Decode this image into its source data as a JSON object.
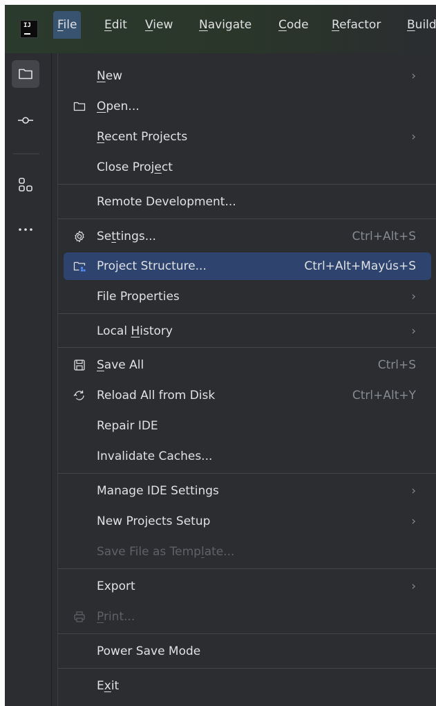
{
  "menubar": {
    "logo_text": "IJ",
    "items": [
      {
        "mnemonic": "F",
        "rest": "ile"
      },
      {
        "mnemonic": "E",
        "rest": "dit"
      },
      {
        "mnemonic": "V",
        "rest": "iew"
      },
      {
        "mnemonic": "N",
        "rest": "avigate"
      },
      {
        "mnemonic": "C",
        "rest": "ode"
      },
      {
        "mnemonic": "R",
        "rest": "efactor"
      },
      {
        "mnemonic": "B",
        "rest": "uild"
      }
    ]
  },
  "toolstripe": {
    "icons": [
      "folder-icon",
      "commit-icon",
      "structure-icon",
      "more-icon"
    ]
  },
  "file_menu": {
    "items": [
      {
        "pre": "",
        "mnemonic": "N",
        "post": "ew",
        "shortcut": "",
        "submenu": true,
        "icon": "",
        "disabled": false,
        "highlighted": false
      },
      {
        "pre": "",
        "mnemonic": "O",
        "post": "pen...",
        "shortcut": "",
        "submenu": false,
        "icon": "folder-icon",
        "disabled": false,
        "highlighted": false
      },
      {
        "pre": "",
        "mnemonic": "R",
        "post": "ecent Projects",
        "shortcut": "",
        "submenu": true,
        "icon": "",
        "disabled": false,
        "highlighted": false
      },
      {
        "pre": "Close Proj",
        "mnemonic": "e",
        "post": "ct",
        "shortcut": "",
        "submenu": false,
        "icon": "",
        "disabled": false,
        "highlighted": false
      },
      {
        "pre": "Remote Development...",
        "mnemonic": "",
        "post": "",
        "shortcut": "",
        "submenu": false,
        "icon": "",
        "disabled": false,
        "highlighted": false
      },
      {
        "pre": "Se",
        "mnemonic": "t",
        "post": "tings...",
        "shortcut": "Ctrl+Alt+S",
        "submenu": false,
        "icon": "gear-icon",
        "disabled": false,
        "highlighted": false
      },
      {
        "pre": "Project Structure...",
        "mnemonic": "",
        "post": "",
        "shortcut": "Ctrl+Alt+Mayús+S",
        "submenu": false,
        "icon": "project-structure-icon",
        "disabled": false,
        "highlighted": true
      },
      {
        "pre": "File Properties",
        "mnemonic": "",
        "post": "",
        "shortcut": "",
        "submenu": true,
        "icon": "",
        "disabled": false,
        "highlighted": false
      },
      {
        "pre": "Local ",
        "mnemonic": "H",
        "post": "istory",
        "shortcut": "",
        "submenu": true,
        "icon": "",
        "disabled": false,
        "highlighted": false
      },
      {
        "pre": "",
        "mnemonic": "S",
        "post": "ave All",
        "shortcut": "Ctrl+S",
        "submenu": false,
        "icon": "save-icon",
        "disabled": false,
        "highlighted": false
      },
      {
        "pre": "Reload All from Disk",
        "mnemonic": "",
        "post": "",
        "shortcut": "Ctrl+Alt+Y",
        "submenu": false,
        "icon": "reload-icon",
        "disabled": false,
        "highlighted": false
      },
      {
        "pre": "Repair IDE",
        "mnemonic": "",
        "post": "",
        "shortcut": "",
        "submenu": false,
        "icon": "",
        "disabled": false,
        "highlighted": false
      },
      {
        "pre": "Invalidate Caches...",
        "mnemonic": "",
        "post": "",
        "shortcut": "",
        "submenu": false,
        "icon": "",
        "disabled": false,
        "highlighted": false
      },
      {
        "pre": "Manage IDE Settings",
        "mnemonic": "",
        "post": "",
        "shortcut": "",
        "submenu": true,
        "icon": "",
        "disabled": false,
        "highlighted": false
      },
      {
        "pre": "New Projects Setup",
        "mnemonic": "",
        "post": "",
        "shortcut": "",
        "submenu": true,
        "icon": "",
        "disabled": false,
        "highlighted": false
      },
      {
        "pre": "Save File as Temp",
        "mnemonic": "l",
        "post": "ate...",
        "shortcut": "",
        "submenu": false,
        "icon": "",
        "disabled": true,
        "highlighted": false
      },
      {
        "pre": "Export",
        "mnemonic": "",
        "post": "",
        "shortcut": "",
        "submenu": true,
        "icon": "",
        "disabled": false,
        "highlighted": false
      },
      {
        "pre": "",
        "mnemonic": "P",
        "post": "rint...",
        "shortcut": "",
        "submenu": false,
        "icon": "print-icon",
        "disabled": true,
        "highlighted": false
      },
      {
        "pre": "Power Save Mode",
        "mnemonic": "",
        "post": "",
        "shortcut": "",
        "submenu": false,
        "icon": "",
        "disabled": false,
        "highlighted": false
      },
      {
        "pre": "E",
        "mnemonic": "x",
        "post": "it",
        "shortcut": "",
        "submenu": false,
        "icon": "",
        "disabled": false,
        "highlighted": false
      }
    ],
    "submenu_glyph": "›"
  },
  "colors": {
    "menu_bg": "#2b2d30",
    "highlight": "#2e436e",
    "text": "#dfe1e5",
    "shortcut": "#868a91",
    "disabled": "#5f6167"
  }
}
